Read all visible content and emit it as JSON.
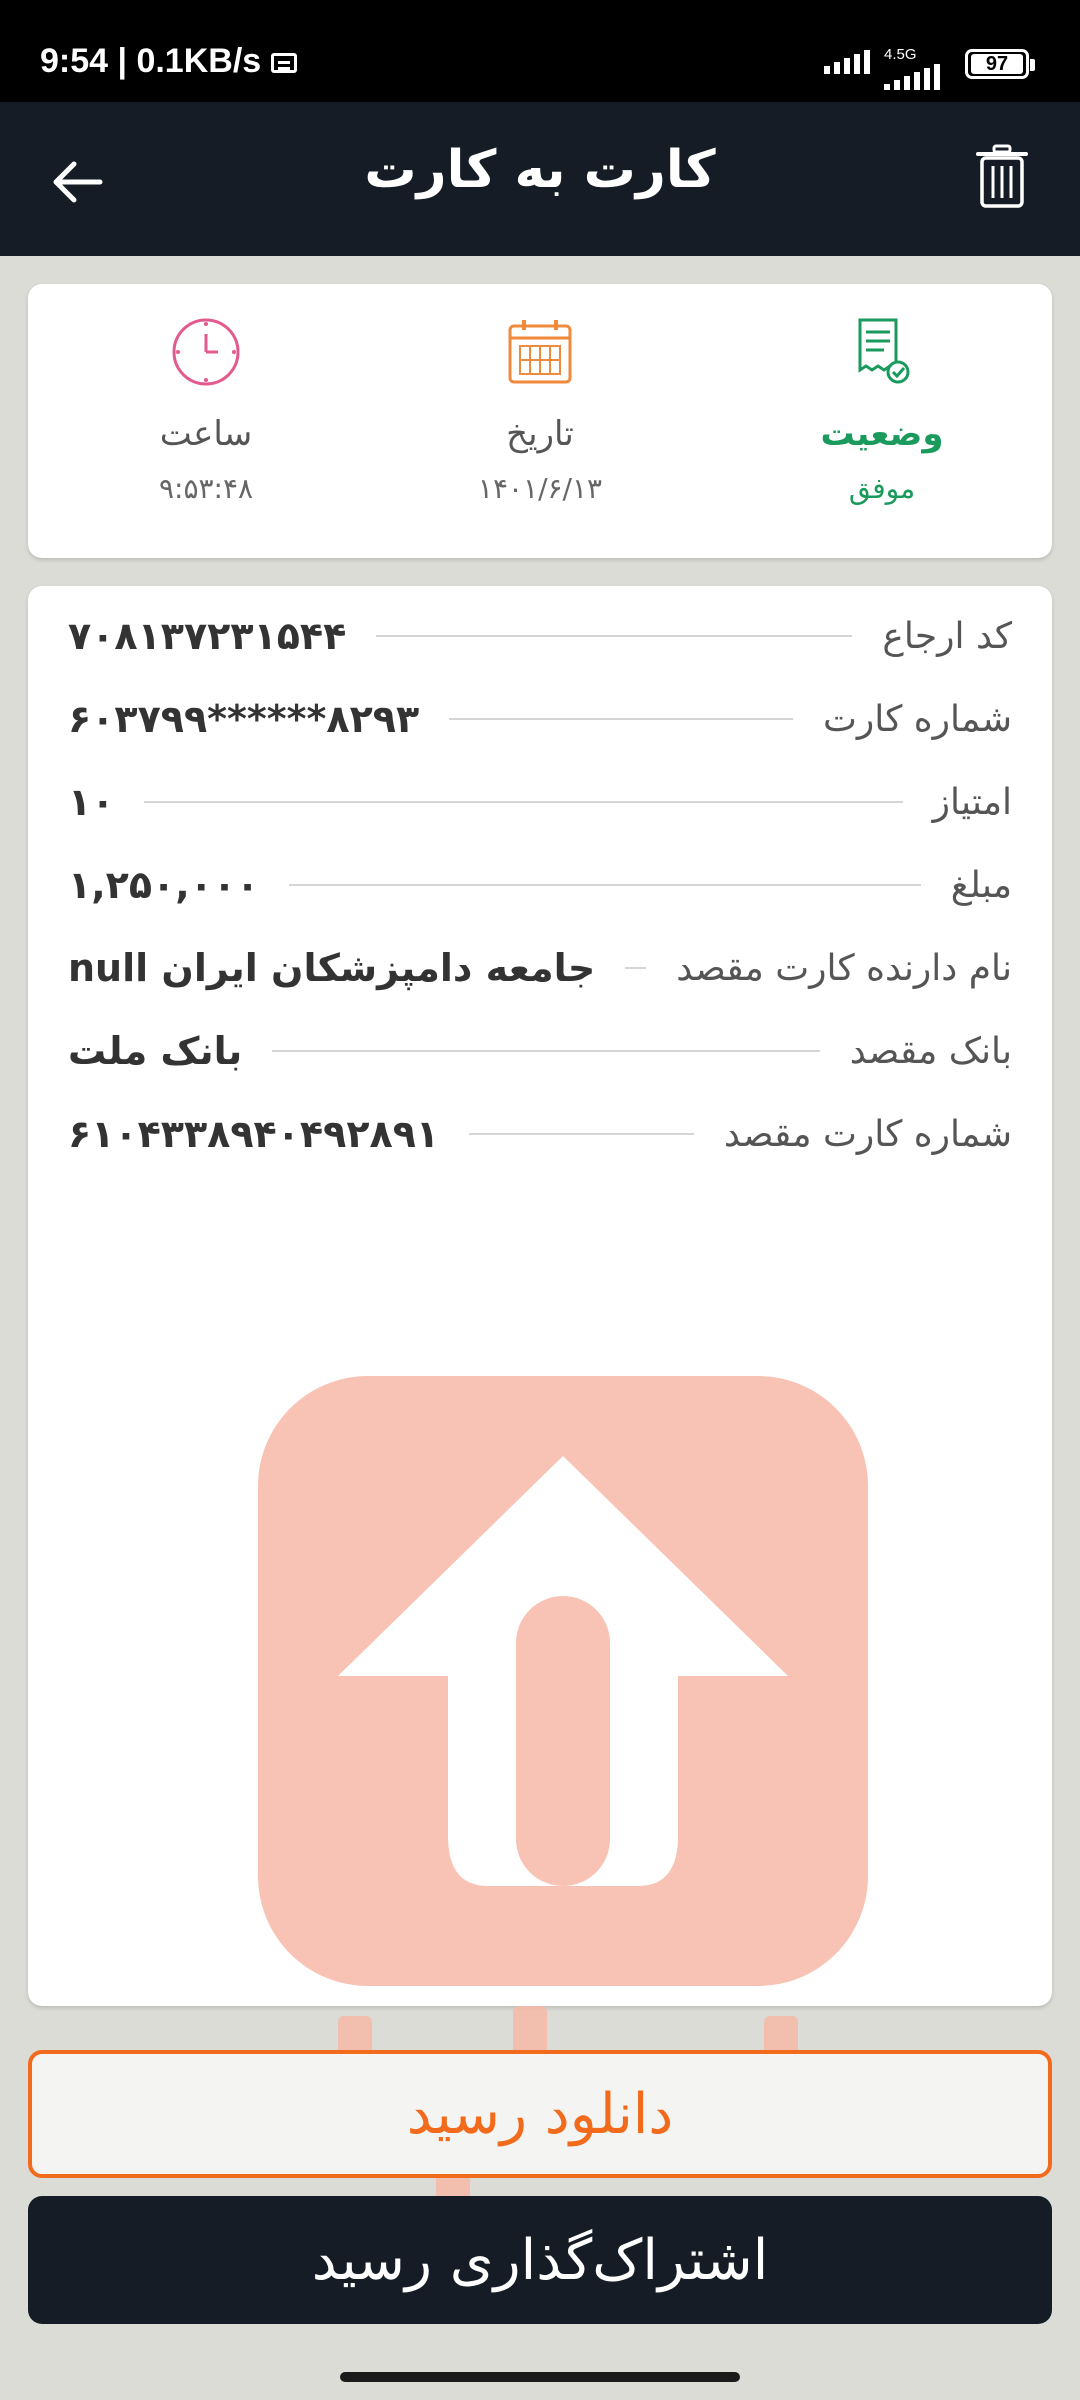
{
  "status_bar": {
    "time": "9:54 | 0.1KB/s",
    "network": "4.5G",
    "battery": "97"
  },
  "app_bar": {
    "title": "کارت به کارت"
  },
  "summary": {
    "status_label": "وضعیت",
    "status_value": "موفق",
    "date_label": "تاریخ",
    "date_value": "۱۴۰۱/۶/۱۳",
    "time_label": "ساعت",
    "time_value": "۹:۵۳:۴۸"
  },
  "details": [
    {
      "label": "کد ارجاع",
      "value": "۷۰۸۱۳۷۲۳۱۵۴۴"
    },
    {
      "label": "شماره کارت",
      "value": "۶۰۳۷۹۹******۸۲۹۳"
    },
    {
      "label": "امتیاز",
      "value": "۱۰"
    },
    {
      "label": "مبلغ",
      "value": "۱,۲۵۰,۰۰۰"
    },
    {
      "label": "نام دارنده کارت مقصد",
      "value": "جامعه دامپزشکان ایران null"
    },
    {
      "label": "بانک مقصد",
      "value": "بانک ملت"
    },
    {
      "label": "شماره کارت مقصد",
      "value": "۶۱۰۴۳۳۸۹۴۰۴۹۲۸۹۱"
    }
  ],
  "buttons": {
    "download": "دانلود رسید",
    "share": "اشتراک‌گذاری رسید"
  },
  "colors": {
    "header": "#151c25",
    "success": "#1a9a5c",
    "accent": "#f26a1b",
    "watermark": "#f7b9a7"
  }
}
